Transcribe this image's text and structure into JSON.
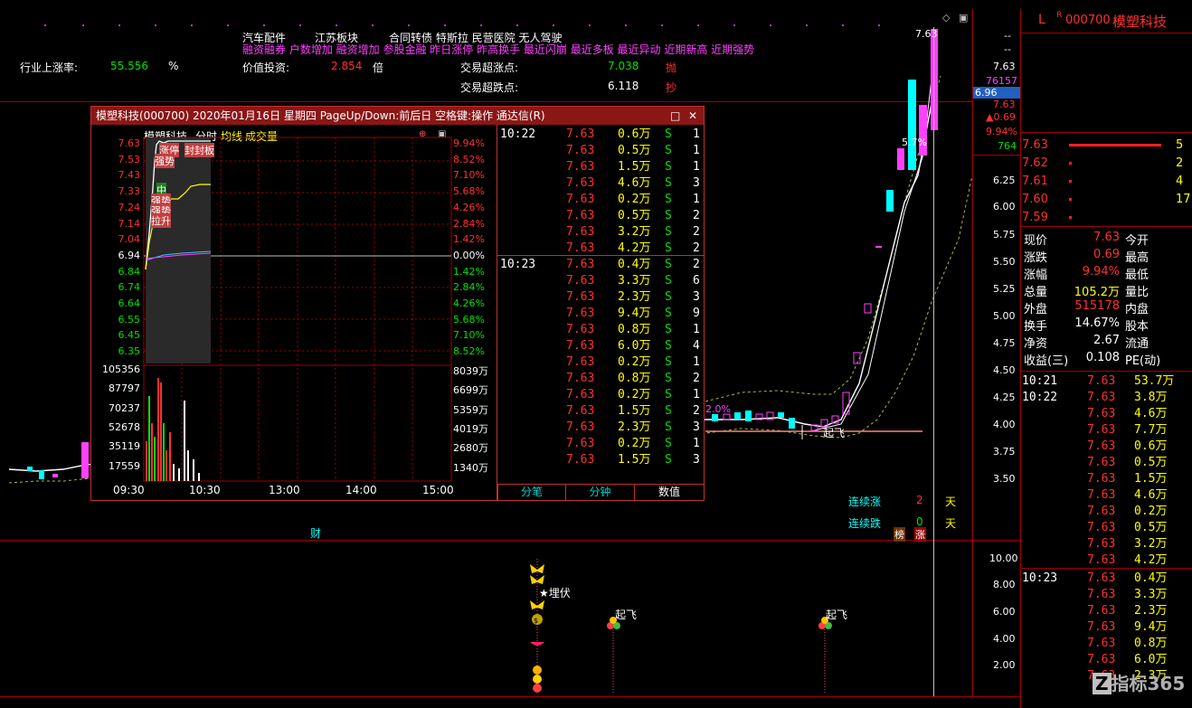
{
  "topbar": {
    "line1": [
      "汽车配件",
      "江苏板块",
      "合同转债 特斯拉 民营医院 无人驾驶"
    ],
    "line2": "融资融券 户数增加 融资增加 参股金融 昨日涨停 昨高换手 最近闪崩 最近多板 最近异动 近期新高 近期强势",
    "industry_rise_label": "行业上涨率:",
    "industry_rise_value": "55.556",
    "industry_rise_unit": "%",
    "value_invest_label": "价值投资:",
    "value_invest_value": "2.854",
    "value_invest_unit": "倍",
    "trade_high_label": "交易超涨点:",
    "trade_high_value": "7.038",
    "trade_high_action": "抛",
    "trade_low_label": "交易超跌点:",
    "trade_low_value": "6.118",
    "trade_low_action": "抄"
  },
  "right_panel": {
    "l_mark": "L",
    "r_mark": "R",
    "code": "000700",
    "name": "模塑科技",
    "stats": [
      {
        "label": "现价",
        "value": "7.63",
        "label2": "今开",
        "color": "r"
      },
      {
        "label": "涨跌",
        "value": "0.69",
        "label2": "最高",
        "color": "r"
      },
      {
        "label": "涨幅",
        "value": "9.94%",
        "label2": "最低",
        "color": "r"
      },
      {
        "label": "总量",
        "value": "105.2万",
        "label2": "量比",
        "color": "y"
      },
      {
        "label": "外盘",
        "value": "515178",
        "label2": "内盘",
        "color": "r"
      },
      {
        "label": "换手",
        "value": "14.67%",
        "label2": "股本",
        "color": "w"
      },
      {
        "label": "净资",
        "value": "2.67",
        "label2": "流通",
        "color": "w"
      },
      {
        "label": "收益(三)",
        "value": "0.108",
        "label2": "PE(动)",
        "color": "w"
      }
    ],
    "stats_right_cut": [
      "5",
      "2",
      "4",
      "17",
      ""
    ],
    "orderbook": [
      {
        "price": "7.63",
        "color": "r"
      },
      {
        "price": "7.62",
        "color": "r"
      },
      {
        "price": "7.61",
        "color": "r"
      },
      {
        "price": "7.60",
        "color": "r"
      },
      {
        "price": "7.59",
        "color": "r"
      }
    ],
    "ticks_1021": {
      "time": "10:21",
      "rows": [
        [
          "7.63",
          "53.7万"
        ]
      ]
    },
    "ticks_1022": {
      "time": "10:22",
      "rows": [
        [
          "7.63",
          "3.8万"
        ],
        [
          "7.63",
          "4.6万"
        ],
        [
          "7.63",
          "7.7万"
        ],
        [
          "7.63",
          "0.6万"
        ],
        [
          "7.63",
          "0.5万"
        ],
        [
          "7.63",
          "1.5万"
        ],
        [
          "7.63",
          "4.6万"
        ],
        [
          "7.63",
          "0.2万"
        ],
        [
          "7.63",
          "0.5万"
        ],
        [
          "7.63",
          "3.2万"
        ],
        [
          "7.63",
          "4.2万"
        ]
      ]
    },
    "ticks_1023": {
      "time": "10:23",
      "rows": [
        [
          "7.63",
          "0.4万"
        ],
        [
          "7.63",
          "3.3万"
        ],
        [
          "7.63",
          "2.3万"
        ],
        [
          "7.63",
          "9.4万"
        ],
        [
          "7.63",
          "0.8万"
        ],
        [
          "7.63",
          "6.0万"
        ],
        [
          "7.63",
          "2.3万"
        ]
      ]
    },
    "watermark": "指标365"
  },
  "main_chart": {
    "top_price": "7.63",
    "price_axis": [
      "--",
      "--",
      "7.63",
      "76157",
      "6.96",
      "7.63",
      "▲0.69",
      "9.94%",
      "764"
    ],
    "axis_ticks": [
      "6.25",
      "6.00",
      "5.75",
      "5.50",
      "5.25",
      "5.00",
      "4.75",
      "4.50",
      "4.25",
      "4.00",
      "3.75",
      "3.50"
    ],
    "pct_label": "2.0%",
    "pct_label2": "5.7%",
    "qifei": "起飞",
    "cai": "财",
    "streak_up_label": "连续涨",
    "streak_up_value": "2",
    "streak_up_unit": "天",
    "streak_down_label": "连续跌",
    "streak_down_value": "0",
    "streak_down_unit": "天",
    "bang": "榜",
    "zhang": "涨"
  },
  "indicator": {
    "axis": [
      "10.00",
      "8.00",
      "6.00",
      "4.00",
      "2.00"
    ],
    "maifu": "★埋伏",
    "qifei1": "起飞",
    "qifei2": "起飞"
  },
  "popup": {
    "title": "模塑科技(000700) 2020年01月16日 星期四 PageUp/Down:前后日 空格键:操作 通达信(R)",
    "tab_name": "模塑科技",
    "tab_fenshi": "分时",
    "tab_junxian": "均线",
    "tab_chengjiao": "成交量",
    "price_axis": [
      "7.63",
      "7.53",
      "7.43",
      "7.33",
      "7.24",
      "7.14",
      "7.04",
      "6.94",
      "6.84",
      "6.74",
      "6.64",
      "6.55",
      "6.45",
      "6.35"
    ],
    "pct_axis": [
      "9.94%",
      "8.52%",
      "7.10%",
      "5.68%",
      "4.26%",
      "2.84%",
      "1.42%",
      "0.00%",
      "1.42%",
      "2.84%",
      "4.26%",
      "5.68%",
      "7.10%",
      "8.52%"
    ],
    "vol_axis_left": [
      "105356",
      "87797",
      "70237",
      "52678",
      "35119",
      "17559"
    ],
    "vol_axis_right": [
      "8039万",
      "6699万",
      "5359万",
      "4019万",
      "2680万",
      "1340万"
    ],
    "time_axis": [
      "09:30",
      "10:30",
      "13:00",
      "14:00",
      "15:00"
    ],
    "tags": [
      "涨停",
      "封封板",
      "强势",
      "中",
      "强势",
      "强势",
      "拉升"
    ],
    "tick_time1": "10:22",
    "tick_time2": "10:23",
    "ticks1": [
      [
        "7.63",
        "0.6万",
        "S",
        "1"
      ],
      [
        "7.63",
        "0.5万",
        "S",
        "1"
      ],
      [
        "7.63",
        "1.5万",
        "S",
        "1"
      ],
      [
        "7.63",
        "4.6万",
        "S",
        "3"
      ],
      [
        "7.63",
        "0.2万",
        "S",
        "1"
      ],
      [
        "7.63",
        "0.5万",
        "S",
        "2"
      ],
      [
        "7.63",
        "3.2万",
        "S",
        "2"
      ],
      [
        "7.63",
        "4.2万",
        "S",
        "2"
      ]
    ],
    "ticks2": [
      [
        "7.63",
        "0.4万",
        "S",
        "2"
      ],
      [
        "7.63",
        "3.3万",
        "S",
        "6"
      ],
      [
        "7.63",
        "2.3万",
        "S",
        "3"
      ],
      [
        "7.63",
        "9.4万",
        "S",
        "9"
      ],
      [
        "7.63",
        "0.8万",
        "S",
        "1"
      ],
      [
        "7.63",
        "6.0万",
        "S",
        "4"
      ],
      [
        "7.63",
        "0.2万",
        "S",
        "1"
      ],
      [
        "7.63",
        "0.8万",
        "S",
        "2"
      ],
      [
        "7.63",
        "0.2万",
        "S",
        "1"
      ],
      [
        "7.63",
        "1.5万",
        "S",
        "2"
      ],
      [
        "7.63",
        "2.3万",
        "S",
        "3"
      ],
      [
        "7.63",
        "0.2万",
        "S",
        "1"
      ],
      [
        "7.63",
        "1.5万",
        "S",
        "3"
      ]
    ],
    "bottom_tabs": [
      "分笔",
      "分钟",
      "数值"
    ]
  },
  "colors": {
    "up": "#ff3030",
    "down": "#00e000",
    "accent": "#ff40ff",
    "grid": "#a00000"
  }
}
